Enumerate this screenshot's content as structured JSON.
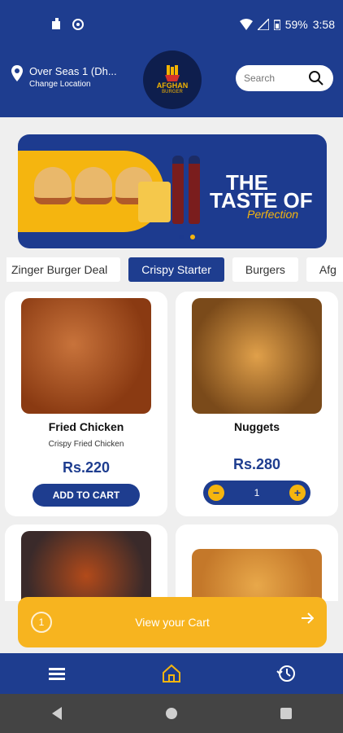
{
  "status": {
    "battery": "59%",
    "time": "3:58"
  },
  "header": {
    "location_name": "Over Seas 1  (Dh...",
    "change_location_label": "Change Location",
    "logo_text": "AFGHAN",
    "logo_sub": "BURGER",
    "search_placeholder": "Search"
  },
  "banner": {
    "line1": "THE",
    "line2": "TASTE OF",
    "line3": "Perfection",
    "active_dot": 1
  },
  "categories": [
    {
      "label": "Zinger Burger Deal",
      "active": false
    },
    {
      "label": "Crispy Starter",
      "active": true
    },
    {
      "label": "Burgers",
      "active": false
    },
    {
      "label": "Afg",
      "active": false
    }
  ],
  "products": [
    {
      "name": "Fried Chicken",
      "desc": "Crispy Fried Chicken",
      "price": "Rs.220",
      "action": "ADD TO CART"
    },
    {
      "name": "Nuggets",
      "desc": "",
      "price": "Rs.280",
      "quantity": "1"
    }
  ],
  "cart": {
    "label": "View your Cart",
    "icon_text": "1"
  },
  "colors": {
    "primary": "#1e3d8f",
    "accent": "#f7b41f"
  }
}
